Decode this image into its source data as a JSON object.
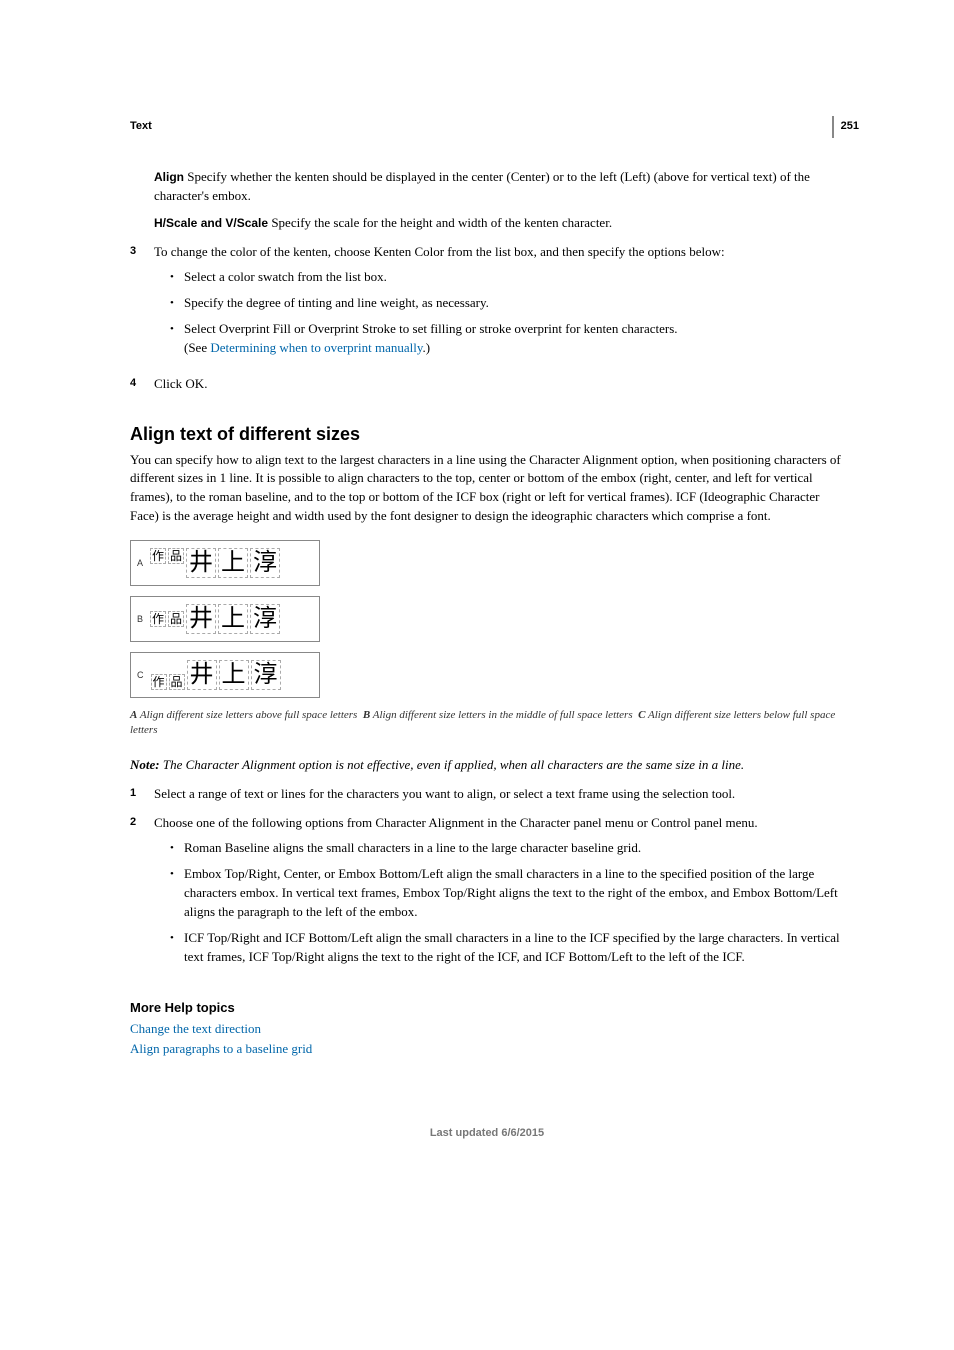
{
  "page": {
    "number": "251",
    "chapter": "Text"
  },
  "defs": {
    "align": {
      "term": "Align",
      "text": "Specify whether the kenten should be displayed in the center (Center) or to the left (Left) (above for vertical text) of the character's embox."
    },
    "scale": {
      "term": "H/Scale and V/Scale",
      "text": "Specify the scale for the height and width of the kenten character."
    }
  },
  "step3": {
    "num": "3",
    "text": "To change the color of the kenten, choose Kenten Color from the list box, and then specify the options below:",
    "b1": "Select a color swatch from the list box.",
    "b2": "Specify the degree of tinting and line weight, as necessary.",
    "b3": "Select Overprint Fill or Overprint Stroke to set filling or stroke overprint for kenten characters.",
    "b3see_prefix": "(See ",
    "b3see_link": "Determining when to overprint manually",
    "b3see_suffix": ".)"
  },
  "step4": {
    "num": "4",
    "text": "Click OK."
  },
  "heading": "Align text of different sizes",
  "intro": "You can specify how to align text to the largest characters in a line using the Character Alignment option, when positioning characters of different sizes in 1 line. It is possible to align characters to the top, center or bottom of the embox (right, center, and left for vertical frames), to the roman baseline, and to the top or bottom of the ICF box (right or left for vertical frames). ICF (Ideographic Character Face) is the average height and width used by the font designer to design the ideographic characters which comprise a font.",
  "figure": {
    "rowA": "A",
    "rowB": "B",
    "rowC": "C",
    "small1": "作",
    "small2": "品",
    "big1": "井",
    "big2": "上",
    "big3": "淳"
  },
  "caption": {
    "la": "A",
    "ta": "Align different size letters above full space letters",
    "lb": "B",
    "tb": "Align different size letters in the middle of full space letters",
    "lc": "C",
    "tc": "Align different size letters below full space letters"
  },
  "note": {
    "label": "Note:",
    "text": "The Character Alignment option is not effective, even if applied, when all characters are the same size in a line."
  },
  "s1": {
    "num": "1",
    "text": "Select a range of text or lines for the characters you want to align, or select a text frame using the selection tool."
  },
  "s2": {
    "num": "2",
    "text": "Choose one of the following options from Character Alignment in the Character panel menu or Control panel menu.",
    "b1": "Roman Baseline aligns the small characters in a line to the large character baseline grid.",
    "b2": "Embox Top/Right, Center, or Embox Bottom/Left align the small characters in a line to the specified position of the large characters embox. In vertical text frames, Embox Top/Right aligns the text to the right of the embox, and Embox Bottom/Left aligns the paragraph to the left of the embox.",
    "b3": "ICF Top/Right and ICF Bottom/Left align the small characters in a line to the ICF specified by the large characters. In vertical text frames, ICF Top/Right aligns the text to the right of the ICF, and ICF Bottom/Left to the left of the ICF."
  },
  "more": {
    "heading": "More Help topics",
    "link1": "Change the text direction",
    "link2": "Align paragraphs to a baseline grid"
  },
  "footer": "Last updated 6/6/2015"
}
